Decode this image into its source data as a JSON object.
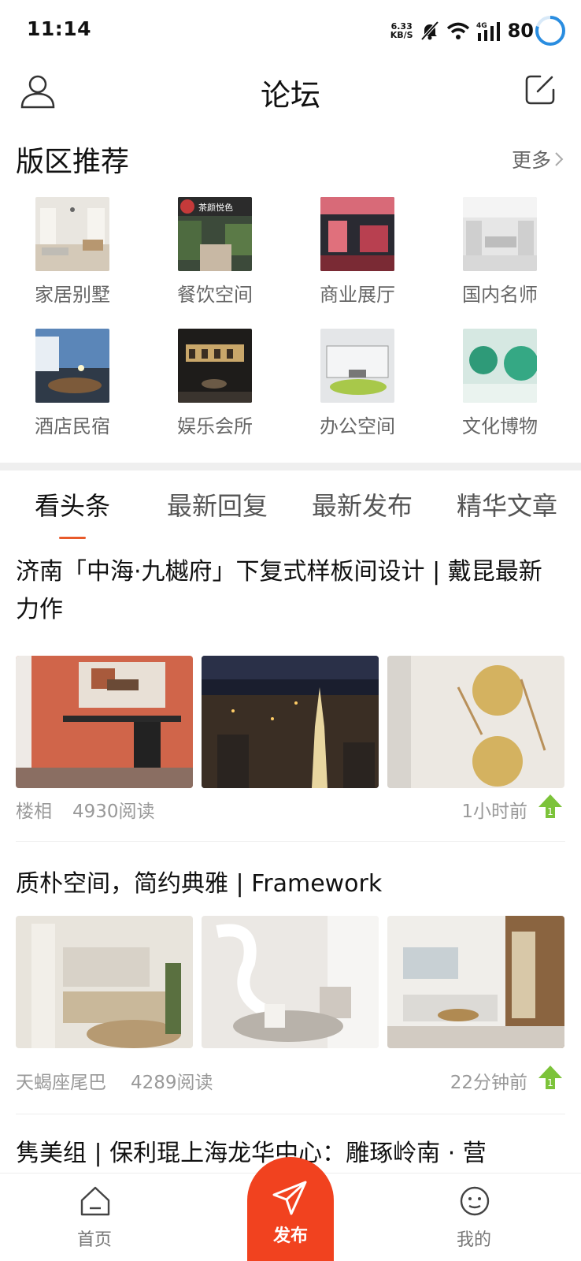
{
  "status_bar": {
    "time": "11:14",
    "net_speed_value": "6.33",
    "net_speed_unit": "KB/S",
    "network_type": "4G",
    "battery": "80"
  },
  "top_bar": {
    "title": "论坛"
  },
  "section": {
    "title": "版区推荐",
    "more_label": "更多"
  },
  "categories": [
    {
      "label": "家居别墅"
    },
    {
      "label": "餐饮空间"
    },
    {
      "label": "商业展厅"
    },
    {
      "label": "国内名师"
    },
    {
      "label": "酒店民宿"
    },
    {
      "label": "娱乐会所"
    },
    {
      "label": "办公空间"
    },
    {
      "label": "文化博物"
    }
  ],
  "category_thumb_text": "茶颜悦色",
  "tabs": [
    {
      "label": "看头条"
    },
    {
      "label": "最新回复"
    },
    {
      "label": "最新发布"
    },
    {
      "label": "精华文章"
    }
  ],
  "articles": [
    {
      "title": "济南「中海·九樾府」下复式样板间设计 | 戴昆最新力作",
      "author": "楼相",
      "reads": "4930阅读",
      "time": "1小时前"
    },
    {
      "title": "质朴空间，简约典雅 | Framework",
      "author": "天蝎座尾巴",
      "reads": "4289阅读",
      "time": "22分钟前"
    },
    {
      "title": "隽美组 | 保利琨上海龙华中心：雕琢岭南 · 营"
    }
  ],
  "bottom_nav": {
    "home_label": "首页",
    "publish_label": "发布",
    "mine_label": "我的"
  },
  "colors": {
    "accent": "#f1421f",
    "tab_underline": "#e85a2a",
    "up_arrow": "#7cc33a",
    "battery_ring": "#2a8de0"
  }
}
